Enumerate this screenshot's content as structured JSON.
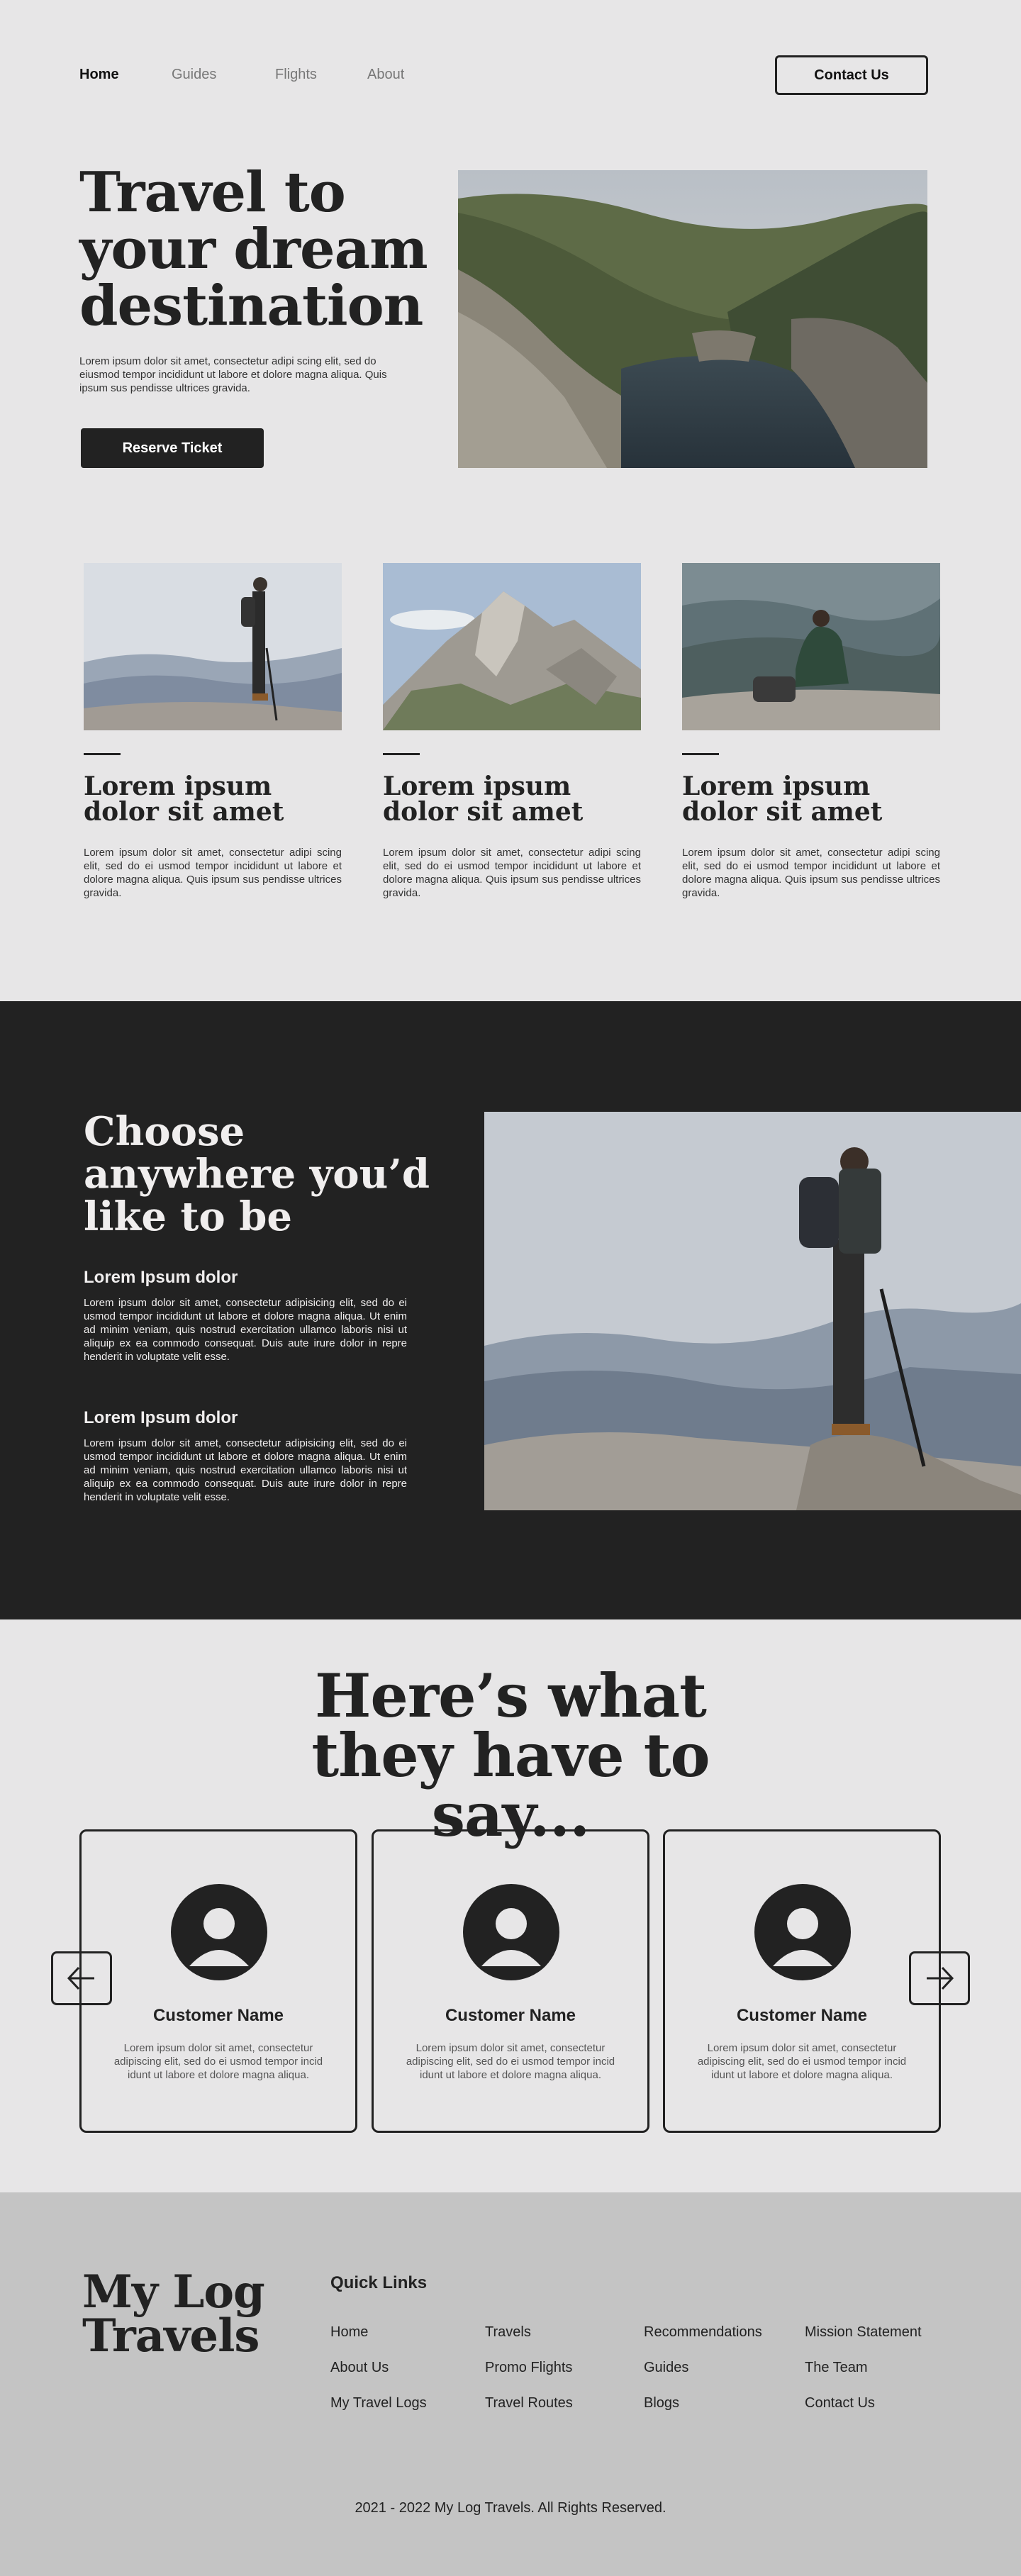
{
  "nav": {
    "links": [
      "Home",
      "Guides",
      "Flights",
      "About"
    ],
    "contact_label": "Contact Us"
  },
  "hero": {
    "title": "Travel to your dream destination",
    "text": "Lorem ipsum dolor sit amet, consectetur adipi scing elit, sed do eiusmod tempor incididunt ut labore et dolore magna aliqua. Quis ipsum sus pendisse ultrices gravida.",
    "button_label": "Reserve Ticket"
  },
  "cards": [
    {
      "title": "Lorem ipsum dolor sit amet",
      "text": "Lorem ipsum dolor sit amet, consectetur adipi scing elit, sed do ei usmod tempor incididunt ut labore et dolore magna aliqua. Quis ipsum sus pendisse ultrices gravida."
    },
    {
      "title": "Lorem ipsum dolor sit amet",
      "text": "Lorem ipsum dolor sit amet, consectetur adipi scing elit, sed do ei usmod tempor incididunt ut labore et dolore magna aliqua. Quis ipsum sus pendisse ultrices gravida."
    },
    {
      "title": "Lorem ipsum dolor sit amet",
      "text": "Lorem ipsum dolor sit amet, consectetur adipi scing elit, sed do ei usmod tempor incididunt ut labore et dolore magna aliqua. Quis ipsum sus pendisse ultrices gravida."
    }
  ],
  "choose": {
    "title": "Choose anywhere you’d like to be",
    "features": [
      {
        "heading": "Lorem Ipsum dolor",
        "text": "Lorem ipsum dolor sit amet, consectetur adipisicing elit, sed do ei usmod tempor incididunt ut labore et dolore magna aliqua. Ut enim ad minim veniam, quis nostrud exercitation ullamco laboris nisi ut aliquip ex ea commodo consequat. Duis aute irure dolor in repre henderit in voluptate velit esse."
      },
      {
        "heading": "Lorem Ipsum dolor",
        "text": "Lorem ipsum dolor sit amet, consectetur adipisicing elit, sed do ei usmod tempor incididunt ut labore et dolore magna aliqua. Ut enim ad minim veniam, quis nostrud exercitation ullamco laboris nisi ut aliquip ex ea commodo consequat. Duis aute irure dolor in repre henderit in voluptate velit esse."
      }
    ]
  },
  "testimonials": {
    "title": "Here’s what they have to say...",
    "items": [
      {
        "name": "Customer Name",
        "text": "Lorem ipsum dolor sit amet, consectetur adipiscing elit, sed do ei usmod tempor incid idunt ut labore et dolore magna aliqua."
      },
      {
        "name": "Customer Name",
        "text": "Lorem ipsum dolor sit amet, consectetur adipiscing elit, sed do ei usmod tempor incid idunt ut labore et dolore magna aliqua."
      },
      {
        "name": "Customer Name",
        "text": "Lorem ipsum dolor sit amet, consectetur adipiscing elit, sed do ei usmod tempor incid idunt ut labore et dolore magna aliqua."
      }
    ]
  },
  "footer": {
    "logo": "My Log Travels",
    "quick_links_title": "Quick Links",
    "links": [
      "Home",
      "About Us",
      "My Travel Logs",
      "Travels",
      "Promo Flights",
      "Travel Routes",
      "Recommendations",
      "Guides",
      "Blogs",
      "Mission Statement",
      "The Team",
      "Contact Us"
    ],
    "copyright": "2021 - 2022 My Log Travels. All Rights Reserved."
  },
  "icons": {
    "prev": "arrow-left-icon",
    "next": "arrow-right-icon",
    "avatar": "user-avatar-icon"
  },
  "colors": {
    "background": "#e7e6e7",
    "dark": "#222222",
    "footer": "#c4c4c4"
  }
}
